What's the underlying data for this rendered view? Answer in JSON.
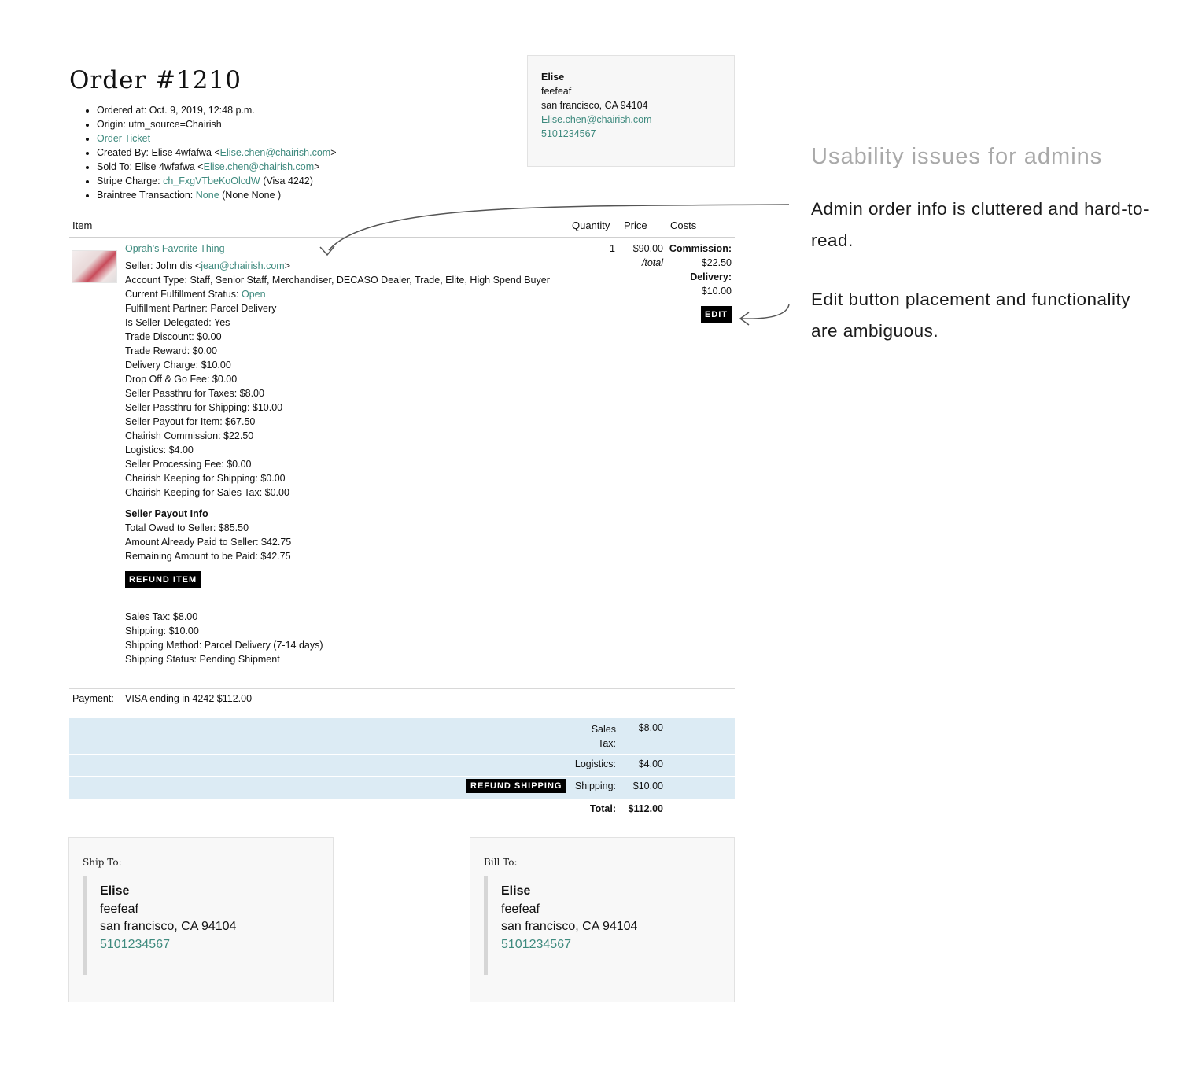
{
  "order": {
    "title": "Order #1210",
    "meta": {
      "ordered_at": "Ordered at: Oct. 9, 2019, 12:48 p.m.",
      "origin": "Origin: utm_source=Chairish",
      "order_ticket": "Order Ticket",
      "created_by_prefix": "Created By: Elise 4wfafwa <",
      "created_by_email": "Elise.chen@chairish.com",
      "sold_to_prefix": "Sold To: Elise 4wfafwa <",
      "sold_to_email": "Elise.chen@chairish.com",
      "close_bracket": ">",
      "stripe_prefix": "Stripe Charge: ",
      "stripe_id": "ch_FxgVTbeKoOlcdW",
      "stripe_suffix": " (Visa 4242)",
      "braintree_prefix": "Braintree Transaction: ",
      "braintree_link": "None",
      "braintree_suffix": " (None None )"
    }
  },
  "contact_card": {
    "name": "Elise",
    "line1": "feefeaf",
    "city": "san francisco, CA  94104",
    "email": "Elise.chen@chairish.com",
    "phone": "5101234567"
  },
  "table": {
    "headers": {
      "item": "Item",
      "quantity": "Quantity",
      "price": "Price",
      "costs": "Costs"
    }
  },
  "item": {
    "name": "Oprah's Favorite Thing",
    "seller_prefix": "Seller: John dis <",
    "seller_email": "jean@chairish.com",
    "seller_suffix": ">",
    "account_type": "Account Type: Staff, Senior Staff, Merchandiser, DECASO Dealer, Trade, Elite, High Spend Buyer",
    "fulfillment_status_prefix": "Current Fulfillment Status: ",
    "fulfillment_status": "Open",
    "lines": [
      "Fulfillment Partner: Parcel Delivery",
      "Is Seller-Delegated: Yes",
      "Trade Discount: $0.00",
      "Trade Reward: $0.00",
      "Delivery Charge: $10.00",
      "Drop Off & Go Fee: $0.00",
      "Seller Passthru for Taxes: $8.00",
      "Seller Passthru for Shipping: $10.00",
      "Seller Payout for Item: $67.50",
      "Chairish Commission: $22.50",
      "Logistics: $4.00",
      "Seller Processing Fee: $0.00",
      "Chairish Keeping for Shipping: $0.00",
      "Chairish Keeping for Sales Tax: $0.00"
    ],
    "payout_heading": "Seller Payout Info",
    "payout_lines": [
      "Total Owed to Seller: $85.50",
      "Amount Already Paid to Seller: $42.75",
      "Remaining Amount to be Paid: $42.75"
    ],
    "refund_item_label": "REFUND ITEM",
    "shipping_lines": [
      "Sales Tax: $8.00",
      "Shipping: $10.00",
      "Shipping Method: Parcel Delivery (7-14 days)",
      "Shipping Status: Pending Shipment"
    ],
    "quantity": "1",
    "price": "$90.00",
    "price_unit": "/total",
    "commission_label": "Commission:",
    "commission_value": "$22.50",
    "delivery_label": "Delivery:",
    "delivery_value": "$10.00",
    "edit_label": "EDIT"
  },
  "payment": {
    "label": "Payment:",
    "value": "VISA ending in 4242 $112.00"
  },
  "summary": {
    "sales_tax_label_1": "Sales",
    "sales_tax_label_2": "Tax:",
    "sales_tax_value": "$8.00",
    "logistics_label": "Logistics:",
    "logistics_value": "$4.00",
    "refund_shipping_label": "REFUND SHIPPING",
    "shipping_label": "Shipping:",
    "shipping_value": "$10.00",
    "total_label": "Total:",
    "total_value": "$112.00"
  },
  "ship_to": {
    "heading": "Ship To:",
    "name": "Elise",
    "line1": "feefeaf",
    "city": "san francisco, CA  94104",
    "phone": "5101234567"
  },
  "bill_to": {
    "heading": "Bill To:",
    "name": "Elise",
    "line1": "feefeaf",
    "city": "san francisco, CA  94104",
    "phone": "5101234567"
  },
  "annotations": {
    "title": "Usability issues for admins",
    "note1": "Admin order info is cluttered and hard-to-read.",
    "note2": "Edit button placement and functionality are ambiguous."
  },
  "colors": {
    "link": "#3e8a7e",
    "summary_bg": "#dcebf4",
    "button_bg": "#000000"
  }
}
